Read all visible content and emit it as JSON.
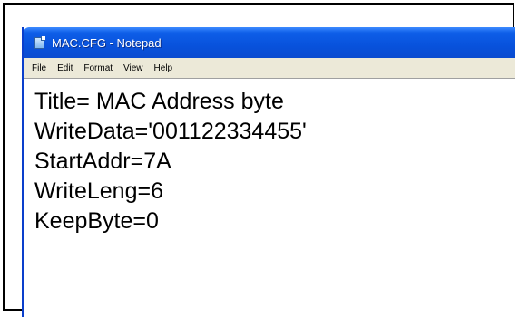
{
  "window": {
    "title": "MAC.CFG - Notepad",
    "icon": "notepad-icon"
  },
  "menu": {
    "items": [
      {
        "label": "File"
      },
      {
        "label": "Edit"
      },
      {
        "label": "Format"
      },
      {
        "label": "View"
      },
      {
        "label": "Help"
      }
    ]
  },
  "editor": {
    "lines": [
      "Title= MAC Address byte",
      "WriteData='001122334455'",
      "StartAddr=7A",
      "WriteLeng=6",
      "KeepByte=0"
    ]
  },
  "colors": {
    "titlebar": "#0852dc",
    "menubar": "#ece9d8",
    "frame_border": "#000000"
  }
}
